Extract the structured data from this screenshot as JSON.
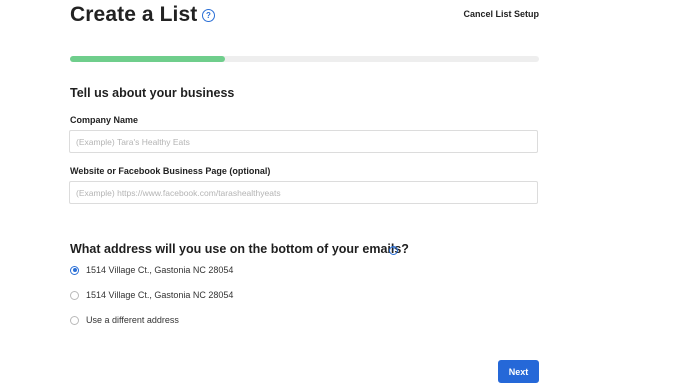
{
  "header": {
    "title": "Create a List",
    "help_icon": "question-circle-icon",
    "cancel_label": "Cancel List Setup"
  },
  "progress": {
    "fraction": 0.33,
    "fill_color": "#6fce8c",
    "track_color": "#eeeeee"
  },
  "business": {
    "heading": "Tell us about your business",
    "company_name": {
      "label": "Company Name",
      "placeholder": "(Example) Tara's Healthy Eats",
      "value": ""
    },
    "website": {
      "label": "Website or Facebook Business Page (optional)",
      "placeholder": "(Example) https://www.facebook.com/tarashealthyeats",
      "value": ""
    }
  },
  "address": {
    "question": "What address will you use on the bottom of your emails?",
    "help_icon": "question-circle-icon",
    "options": [
      {
        "label": "1514 Village Ct., Gastonia NC 28054",
        "selected": true
      },
      {
        "label": "1514 Village Ct., Gastonia NC 28054",
        "selected": false
      },
      {
        "label": "Use a different address",
        "selected": false
      }
    ]
  },
  "footer": {
    "next_label": "Next",
    "accent_color": "#2568d8"
  }
}
